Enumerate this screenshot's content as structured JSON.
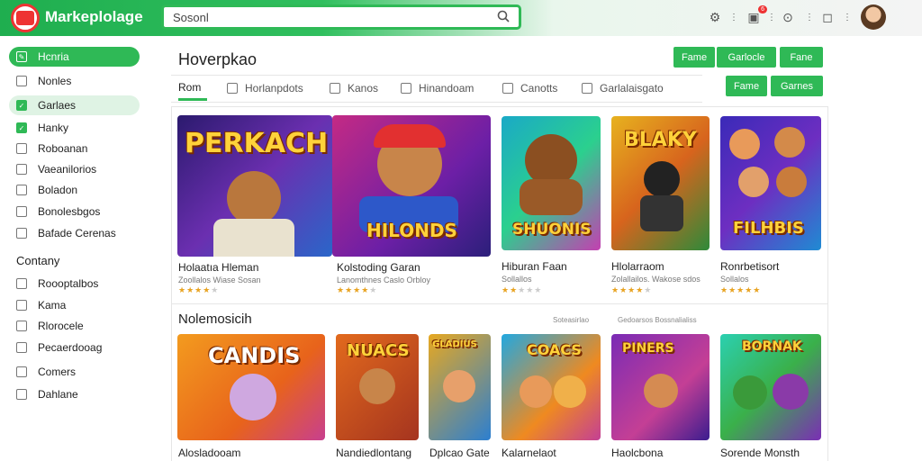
{
  "header": {
    "brand": "Markeplolage",
    "search_value": "Sosonl",
    "notif_count": "6"
  },
  "sidebar": {
    "items": [
      {
        "label": "Hcnria",
        "icon": "pencil-icon"
      },
      {
        "label": "Nonles",
        "icon": "square-icon"
      },
      {
        "label": "Garlaes",
        "icon": "check-icon"
      },
      {
        "label": "Hanky",
        "icon": "check-icon"
      },
      {
        "label": "Roboanan",
        "icon": "square-icon"
      },
      {
        "label": "Vaeanilorios",
        "icon": "square-icon"
      },
      {
        "label": "Boladon",
        "icon": "square-icon"
      },
      {
        "label": "Bonolesbgos",
        "icon": "square-icon"
      },
      {
        "label": "Bafade Cerenas",
        "icon": "square-icon"
      }
    ],
    "section_title": "Contany",
    "items2": [
      {
        "label": "Roooptalbos",
        "icon": "square-icon"
      },
      {
        "label": "Kama",
        "icon": "square-icon"
      },
      {
        "label": "Rlorocele",
        "icon": "square-icon"
      },
      {
        "label": "Pecaerdooag",
        "icon": "square-icon"
      },
      {
        "label": "Comers",
        "icon": "square-icon"
      },
      {
        "label": "Dahlane",
        "icon": "square-icon"
      }
    ]
  },
  "main": {
    "title": "Hoverpkao",
    "top_buttons": [
      "Fame",
      "Garlocle",
      "Fane"
    ],
    "row_buttons": [
      "Fame",
      "Garnes"
    ],
    "tabs": [
      {
        "label": "Rom",
        "icon": ""
      },
      {
        "label": "Horlanpdots",
        "icon": "grid-icon"
      },
      {
        "label": "Kanos",
        "icon": "tag-icon"
      },
      {
        "label": "Hinandoam",
        "icon": "box-icon"
      },
      {
        "label": "Canotts",
        "icon": "link-icon"
      },
      {
        "label": "Garlalaisgato",
        "icon": "image-icon"
      }
    ],
    "featured": [
      {
        "art": "PERKACH",
        "title": "Holaatıa Hleman",
        "sub": "Zoollalos Wiase Sosan",
        "rating": 4
      },
      {
        "art": "HILONDS",
        "title": "Kolstoding Garan",
        "sub": "Lanomthnes Caslo Orbloy",
        "rating": 4
      },
      {
        "art": "SHUONIS",
        "title": "Hiburan Faan",
        "sub": "Sollallos",
        "rating": 2
      },
      {
        "art": "BLAKY",
        "title": "Hlolarraom",
        "sub": "Zolallailos. Wakose sdos",
        "rating": 4
      },
      {
        "art": "FILHBIS",
        "title": "Ronrbetisort",
        "sub": "Sollalos",
        "rating": 5
      }
    ],
    "section2_title": "Nolemosicih",
    "section2_links": [
      "Soteasirlao",
      "Gedoarsos Bossnalialiss"
    ],
    "row2": [
      {
        "art": "CANDIS",
        "title": "Alosladooam"
      },
      {
        "art": "NUACS",
        "title": "Nandiedlontang"
      },
      {
        "art": "GLADIUS",
        "title": "Dplcao Gate"
      },
      {
        "art": "COACS",
        "title": "Kalarnelaot"
      },
      {
        "art": "PINERS",
        "title": "Haolcbona"
      },
      {
        "art": "BORNAK",
        "title": "Sorende Monsth"
      }
    ]
  },
  "colors": {
    "accent": "#2fb956",
    "header_dark": "#1fae4f"
  }
}
